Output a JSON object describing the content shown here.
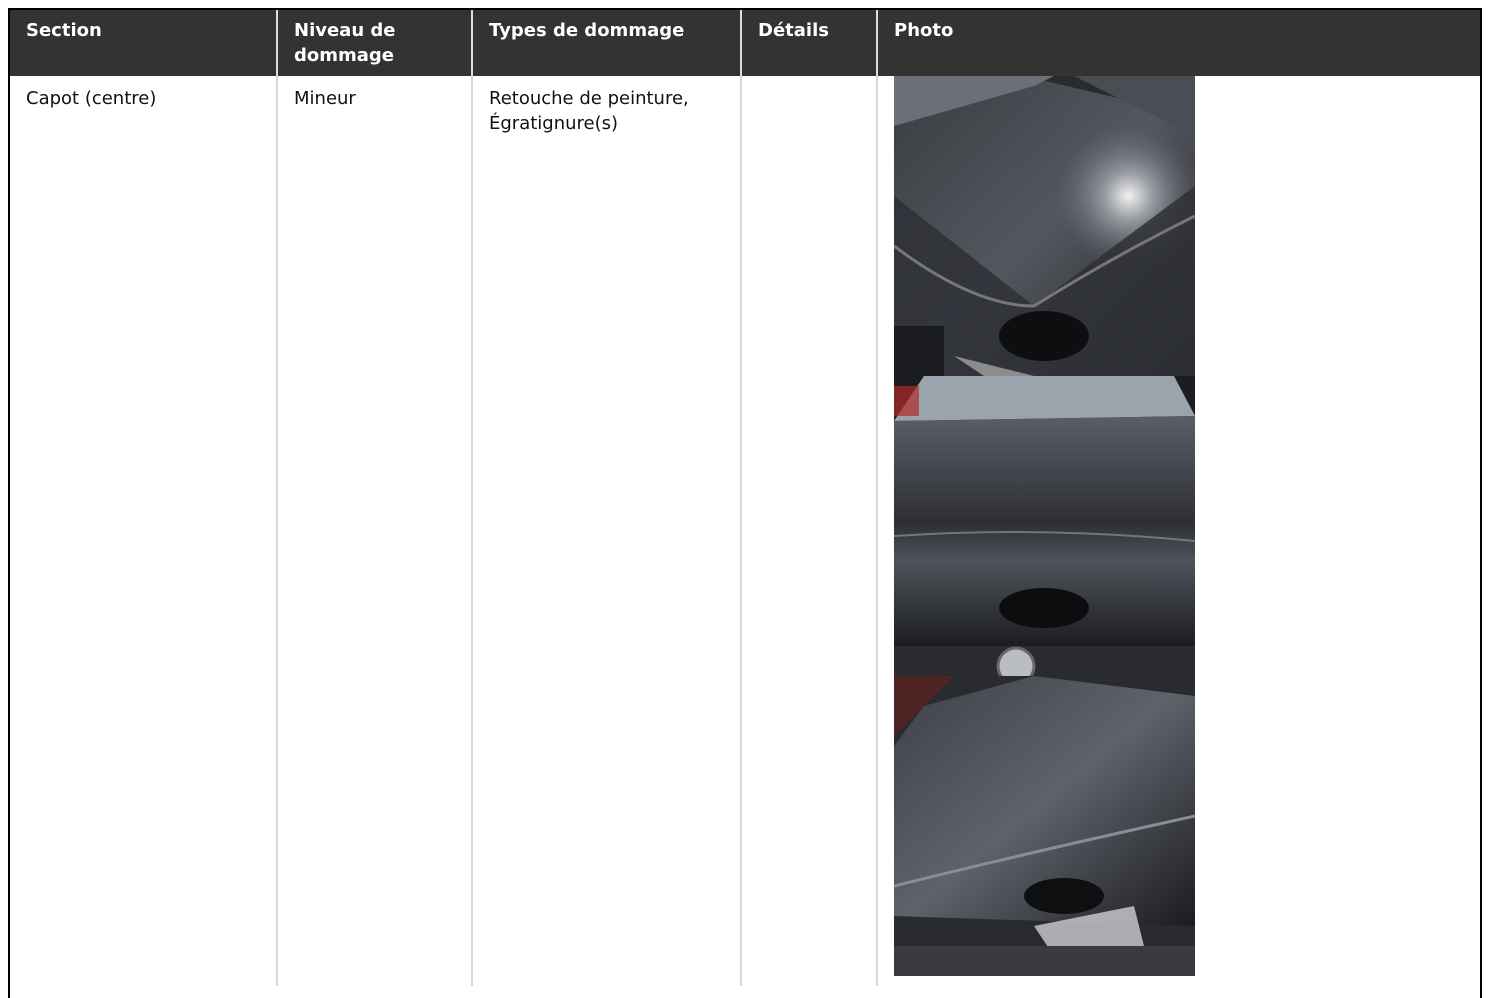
{
  "table": {
    "headers": [
      "Section",
      "Niveau de dommage",
      "Types de dommage",
      "Détails",
      "Photo"
    ],
    "rows": [
      {
        "section": "Capot (centre)",
        "niveau": "Mineur",
        "types": "Retouche de peinture, Égratignure(s)",
        "details": "",
        "photos": [
          {
            "icon": "car-hood-photo"
          },
          {
            "icon": "car-hood-photo"
          },
          {
            "icon": "car-hood-photo"
          }
        ]
      }
    ]
  },
  "colors": {
    "header_bg": "#333333",
    "header_text": "#ffffff",
    "cell_divider": "#d6d6d6",
    "frame": "#000000"
  }
}
